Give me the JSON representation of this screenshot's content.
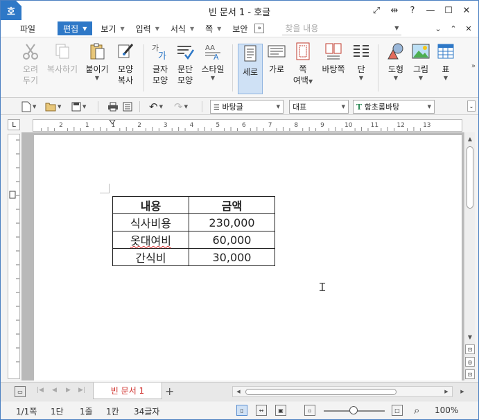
{
  "window": {
    "app_icon_letter": "호",
    "title": "빈 문서 1 - 호글",
    "help": "?"
  },
  "menu": {
    "items": [
      {
        "label": "파일",
        "dropdown": false
      },
      {
        "label": "편집",
        "dropdown": true,
        "active": true
      },
      {
        "label": "보기",
        "dropdown": true
      },
      {
        "label": "입력",
        "dropdown": true
      },
      {
        "label": "서식",
        "dropdown": true
      },
      {
        "label": "쪽",
        "dropdown": true
      },
      {
        "label": "보안",
        "dropdown": false
      }
    ],
    "find_placeholder": "찾을 내용"
  },
  "ribbon": {
    "cut": {
      "line1": "오려",
      "line2": "두기"
    },
    "copy": {
      "line1": "복사하기"
    },
    "paste": {
      "line1": "붙이기"
    },
    "format_copy": {
      "line1": "모양",
      "line2": "복사"
    },
    "char_shape": {
      "line1": "글자",
      "line2": "모양"
    },
    "para_shape": {
      "line1": "문단",
      "line2": "모양"
    },
    "style": {
      "line1": "스타일"
    },
    "portrait": {
      "line1": "세로"
    },
    "landscape": {
      "line1": "가로"
    },
    "margins": {
      "line1": "쪽",
      "line2": "여백"
    },
    "page_bg": {
      "line1": "바탕쪽"
    },
    "columns": {
      "line1": "단"
    },
    "shapes": {
      "line1": "도형"
    },
    "picture": {
      "line1": "그림"
    },
    "table": {
      "line1": "표"
    }
  },
  "toolbar": {
    "style_combo": "바탕글",
    "font_lang_combo": "대표",
    "font_combo": "함초롬바탕"
  },
  "ruler": {
    "ticks": [
      "2",
      "1",
      "1",
      "2",
      "3",
      "4",
      "5",
      "6",
      "7",
      "8",
      "9",
      "10",
      "11",
      "12",
      "13"
    ]
  },
  "document": {
    "table": {
      "header": [
        "내용",
        "금액"
      ],
      "rows": [
        [
          "식사비용",
          "230,000"
        ],
        [
          "옷대여비",
          "60,000"
        ],
        [
          "간식비",
          "30,000"
        ]
      ]
    }
  },
  "tabs": {
    "doc_tab": "빈 문서 1",
    "add": "+"
  },
  "status": {
    "page": "1/1쪽",
    "column": "1단",
    "line": "1줄",
    "col": "1칸",
    "chars": "34글자",
    "zoom": "100%"
  }
}
